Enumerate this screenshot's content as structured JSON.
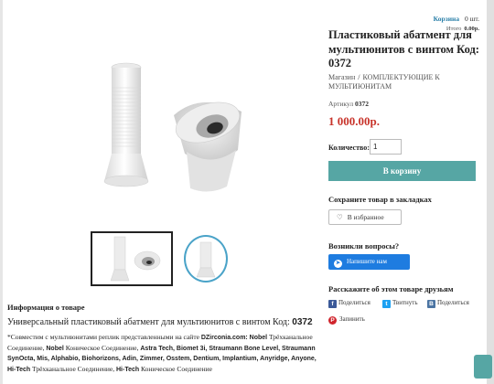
{
  "cart": {
    "label": "Корзина",
    "count": "0",
    "count_unit": "шт.",
    "total_label": "Итого",
    "total_value": "0.00р."
  },
  "product": {
    "title": "Пластиковый абатмент для мультиюнитов с винтом Код: 0372",
    "breadcrumbs": [
      "Магазин",
      "КОМПЛЕКТУЮЩИЕ К МУЛЬТИЮНИТАМ"
    ],
    "breadcrumb_separator": "/",
    "sku_label": "Артикул",
    "sku": "0372",
    "price": "1 000.00р.",
    "quantity_label": "Количество:",
    "quantity_value": "1",
    "add_to_cart_label": "В корзину",
    "price_color": "#c8342b",
    "accent_color": "#56a6a4"
  },
  "bookmarks": {
    "heading": "Сохраните товар в закладках",
    "favorite_label": "В избранное",
    "favorite_icon": "heart-icon"
  },
  "questions": {
    "heading": "Возникли вопросы?",
    "message_label": "Напишите нам",
    "message_icon": "messenger-icon",
    "button_color": "#1e7ce0"
  },
  "share": {
    "heading": "Расскажите об этом товаре друзьям",
    "facebook_label": "Поделиться",
    "twitter_label": "Твитнуть",
    "vk_label": "Поделиться",
    "pinterest_label": "Запинить"
  },
  "info": {
    "heading": "Информация о товаре",
    "lead_text": "Универсальный пластиковый абатмент для мультиюнитов с винтом Код:",
    "lead_code": "0372",
    "body_intro": "*Совместим с мультиюнитами реплик представленными на сайте",
    "site": "DZirconia.com:",
    "b1": "Nobel",
    "t1": "Трёхканальное Соединение,",
    "b2": "Nobel",
    "t2": "Коническое Соединение,",
    "b3": "Astra Tech, Biomet 3i, Straumann Bone Level, Straumann SynOcta, Mis, Alphabio, Biohorizons, Adin, Zimmer, Osstem, Dentium, Implantium, Anyridge, Anyone, Hi-Tech",
    "t3": "Трёхканальное Соединение,",
    "b4": "Hi-Tech",
    "t4": "Коническое Соединение"
  }
}
